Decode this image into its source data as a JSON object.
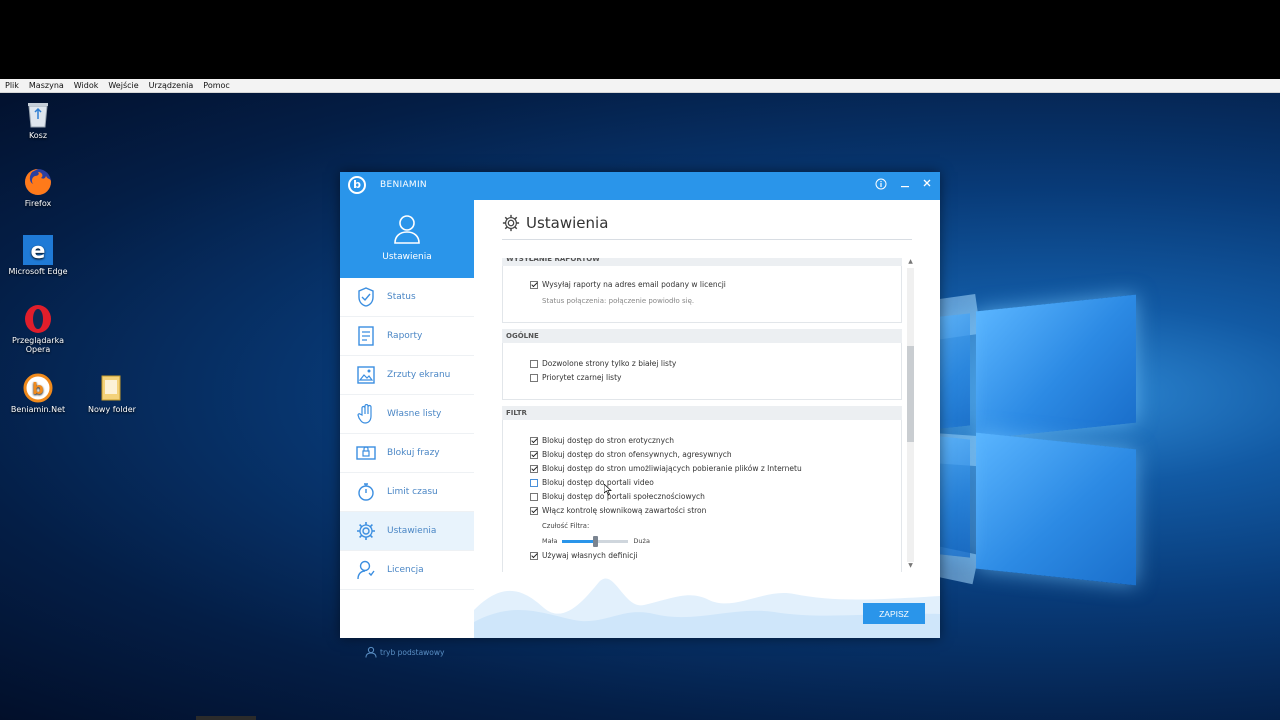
{
  "vm_menu": [
    "Plik",
    "Maszyna",
    "Widok",
    "Wejście",
    "Urządzenia",
    "Pomoc"
  ],
  "desktop_icons": [
    {
      "label": "Kosz",
      "icon": "recycle-bin-icon"
    },
    {
      "label": "Firefox",
      "icon": "firefox-icon"
    },
    {
      "label": "Microsoft Edge",
      "icon": "edge-icon"
    },
    {
      "label": "Przeglądarka Opera",
      "icon": "opera-icon"
    },
    {
      "label": "Beniamin.Net",
      "icon": "beniamin-icon"
    },
    {
      "label": "Nowy folder",
      "icon": "folder-icon"
    }
  ],
  "app": {
    "title": "BENIAMIN",
    "logo_letter": "b",
    "sidebar_top_label": "Ustawienia",
    "nav": [
      {
        "label": "Status",
        "icon": "shield-icon"
      },
      {
        "label": "Raporty",
        "icon": "report-icon"
      },
      {
        "label": "Zrzuty ekranu",
        "icon": "screenshot-icon"
      },
      {
        "label": "Własne listy",
        "icon": "hand-icon"
      },
      {
        "label": "Blokuj frazy",
        "icon": "block-phrase-icon"
      },
      {
        "label": "Limit czasu",
        "icon": "stopwatch-icon"
      },
      {
        "label": "Ustawienia",
        "icon": "gear-icon"
      },
      {
        "label": "Licencja",
        "icon": "license-icon"
      }
    ],
    "active_nav": "Ustawienia",
    "basic_mode": "tryb podstawowy",
    "content_title": "Ustawienia",
    "sections": {
      "reports": {
        "header": "WYSYŁANIE RAPORTÓW",
        "send_reports": {
          "label": "Wysyłaj raporty na adres email podany w licencji",
          "checked": true
        },
        "status": "Status połączenia: połączenie powiodło się."
      },
      "general": {
        "header": "OGÓLNE",
        "whitelist_only": {
          "label": "Dozwolone strony tylko z białej listy",
          "checked": false
        },
        "blacklist_priority": {
          "label": "Priorytet czarnej listy",
          "checked": false
        }
      },
      "filter": {
        "header": "FILTR",
        "items": [
          {
            "label": "Blokuj dostęp do stron erotycznych",
            "checked": true
          },
          {
            "label": "Blokuj dostęp do stron ofensywnych, agresywnych",
            "checked": true
          },
          {
            "label": "Blokuj dostęp do stron umożliwiających pobieranie plików z Internetu",
            "checked": true
          },
          {
            "label": "Blokuj dostęp do portali video",
            "checked": false
          },
          {
            "label": "Blokuj dostęp do portali społecznościowych",
            "checked": false
          },
          {
            "label": "Włącz kontrolę słownikową zawartości stron",
            "checked": true
          }
        ],
        "sensitivity_label": "Czułość Filtra:",
        "sensitivity_min": "Mała",
        "sensitivity_max": "Duża",
        "sensitivity_value": 0.5,
        "own_definitions": {
          "label": "Używaj własnych definicji",
          "checked": true
        }
      }
    },
    "save_label": "ZAPISZ"
  }
}
